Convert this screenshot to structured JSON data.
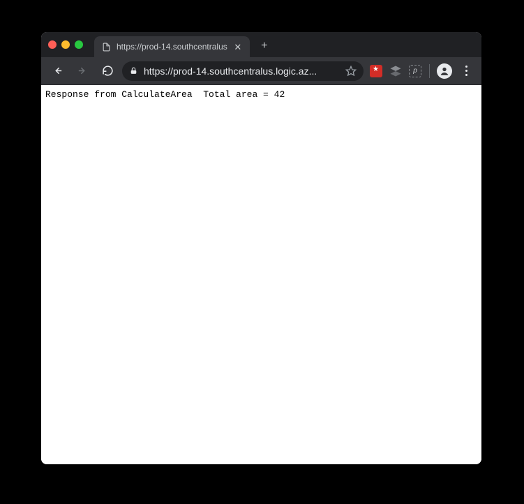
{
  "tab": {
    "title": "https://prod-14.southcentralus"
  },
  "omnibox": {
    "url": "https://prod-14.southcentralus.logic.az..."
  },
  "extensions": {
    "pocket_label": "p"
  },
  "page": {
    "body_text": "Response from CalculateArea  Total area = 42"
  }
}
